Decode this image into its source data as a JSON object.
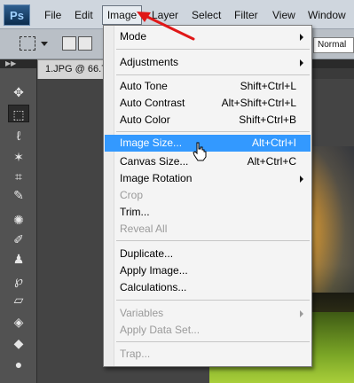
{
  "app": {
    "logo_text": "Ps"
  },
  "menubar": {
    "items": [
      {
        "label": "File"
      },
      {
        "label": "Edit"
      },
      {
        "label": "Image"
      },
      {
        "label": "Layer"
      },
      {
        "label": "Select"
      },
      {
        "label": "Filter"
      },
      {
        "label": "View"
      },
      {
        "label": "Window"
      }
    ]
  },
  "options_bar": {
    "style_value": "Normal"
  },
  "document": {
    "tab_title": "1.JPG @ 66.7"
  },
  "image_menu": {
    "items": [
      {
        "label": "Mode",
        "submenu": true
      },
      {
        "label": "Adjustments",
        "submenu": true
      },
      {
        "label": "Auto Tone",
        "shortcut": "Shift+Ctrl+L"
      },
      {
        "label": "Auto Contrast",
        "shortcut": "Alt+Shift+Ctrl+L"
      },
      {
        "label": "Auto Color",
        "shortcut": "Shift+Ctrl+B"
      },
      {
        "label": "Image Size...",
        "shortcut": "Alt+Ctrl+I",
        "highlighted": true
      },
      {
        "label": "Canvas Size...",
        "shortcut": "Alt+Ctrl+C"
      },
      {
        "label": "Image Rotation",
        "submenu": true
      },
      {
        "label": "Crop",
        "disabled": true
      },
      {
        "label": "Trim..."
      },
      {
        "label": "Reveal All",
        "disabled": true
      },
      {
        "label": "Duplicate..."
      },
      {
        "label": "Apply Image..."
      },
      {
        "label": "Calculations..."
      },
      {
        "label": "Variables",
        "submenu": true,
        "disabled": true
      },
      {
        "label": "Apply Data Set...",
        "disabled": true
      },
      {
        "label": "Trap...",
        "disabled": true
      }
    ]
  },
  "colors": {
    "menu_highlight": "#3399ff",
    "annotation_arrow": "#e01818",
    "disabled_text": "#9a9a9a"
  },
  "icons": [
    "move-icon",
    "marquee-icon",
    "lasso-icon",
    "magic-wand-icon",
    "crop-icon",
    "eyedropper-icon",
    "healing-brush-icon",
    "brush-icon",
    "clone-stamp-icon",
    "history-brush-icon",
    "eraser-icon",
    "paint-bucket-icon",
    "blur-icon",
    "dodge-icon"
  ]
}
